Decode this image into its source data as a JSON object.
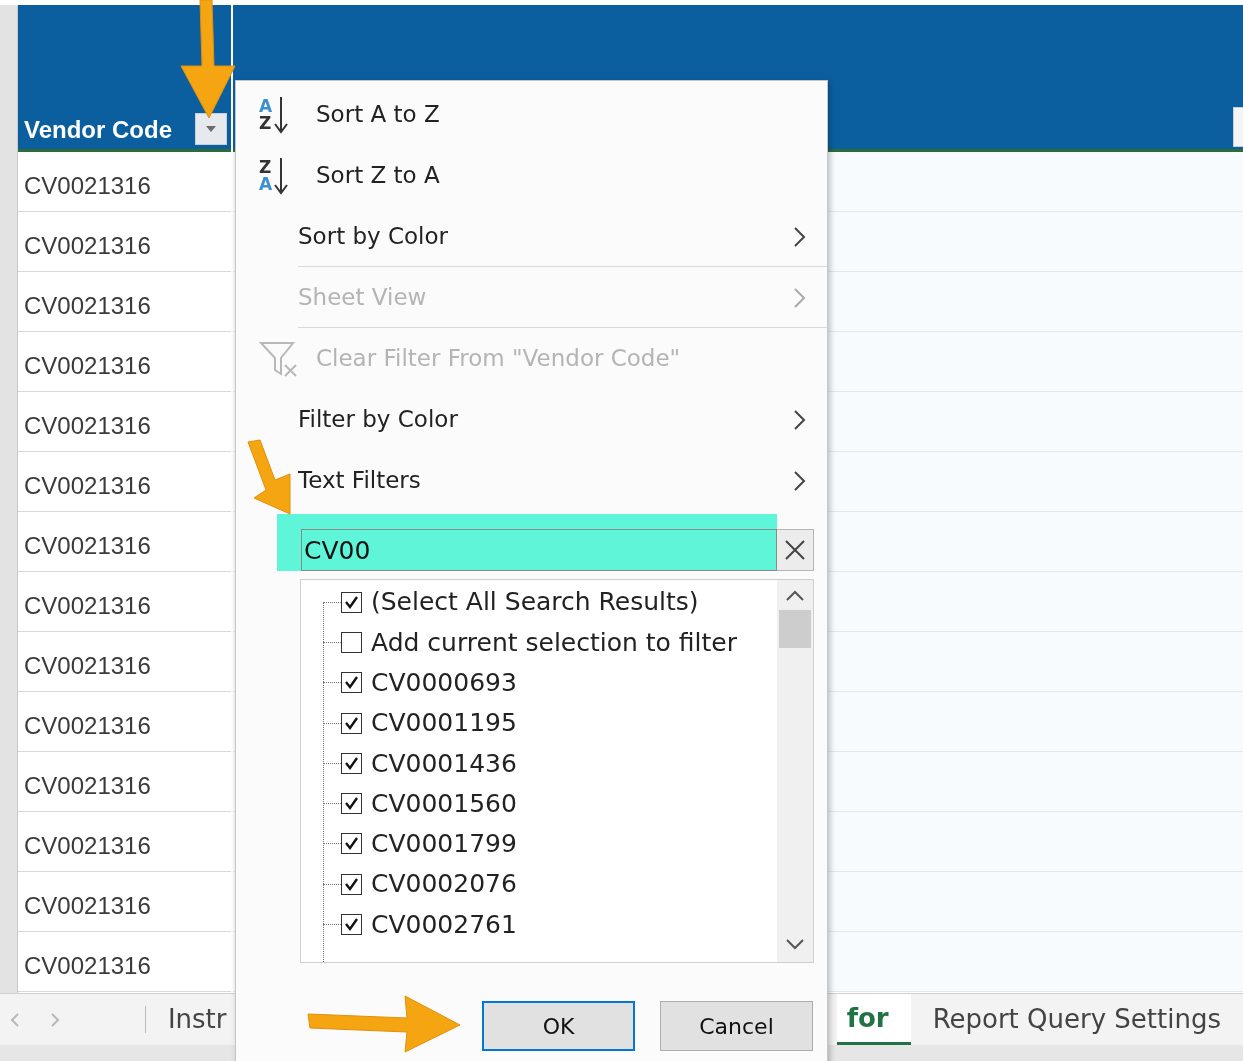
{
  "sheet": {
    "columns": [
      {
        "header": "Vendor Code",
        "filter_button": true
      }
    ],
    "rows": [
      {
        "vendor_code": "CV0021316"
      },
      {
        "vendor_code": "CV0021316"
      },
      {
        "vendor_code": "CV0021316"
      },
      {
        "vendor_code": "CV0021316"
      },
      {
        "vendor_code": "CV0021316"
      },
      {
        "vendor_code": "CV0021316"
      },
      {
        "vendor_code": "CV0021316"
      },
      {
        "vendor_code": "CV0021316"
      },
      {
        "vendor_code": "CV0021316"
      },
      {
        "vendor_code": "CV0021316"
      },
      {
        "vendor_code": "CV0021316"
      },
      {
        "vendor_code": "CV0021316"
      },
      {
        "vendor_code": "CV0021316"
      },
      {
        "vendor_code": "CV0021316"
      }
    ]
  },
  "sheet_tabs": [
    {
      "label": "Instr",
      "selected": false
    },
    {
      "label": "for",
      "selected": true
    },
    {
      "label": "Report Query Settings",
      "selected": false
    }
  ],
  "filter_menu": {
    "items": [
      {
        "kind": "sort",
        "label": "Sort A to Z",
        "disabled": false,
        "divider_after": false,
        "icon_letters": [
          {
            "text": "A",
            "accent": true
          },
          {
            "text": "Z",
            "accent": false
          }
        ]
      },
      {
        "kind": "sort",
        "label": "Sort Z to A",
        "disabled": false,
        "divider_after": false,
        "icon_letters": [
          {
            "text": "Z",
            "accent": false
          },
          {
            "text": "A",
            "accent": true
          }
        ]
      },
      {
        "kind": "submenu",
        "label": "Sort by Color",
        "disabled": false,
        "divider_after": true
      },
      {
        "kind": "submenu",
        "label": "Sheet View",
        "disabled": true,
        "divider_after": true
      },
      {
        "kind": "clear",
        "label": "Clear Filter From \"Vendor Code\"",
        "disabled": true,
        "divider_after": false
      },
      {
        "kind": "submenu",
        "label": "Filter by Color",
        "disabled": false,
        "divider_after": false
      },
      {
        "kind": "submenu",
        "label": "Text Filters",
        "disabled": false,
        "divider_after": false
      }
    ],
    "search": {
      "value": "CV00",
      "highlighted": true
    },
    "list": [
      {
        "label": "(Select All Search Results)",
        "checked": true
      },
      {
        "label": "Add current selection to filter",
        "checked": false
      },
      {
        "label": "CV0000693",
        "checked": true
      },
      {
        "label": "CV0001195",
        "checked": true
      },
      {
        "label": "CV0001436",
        "checked": true
      },
      {
        "label": "CV0001560",
        "checked": true
      },
      {
        "label": "CV0001799",
        "checked": true
      },
      {
        "label": "CV0002076",
        "checked": true
      },
      {
        "label": "CV0002761",
        "checked": true
      }
    ],
    "buttons": [
      {
        "label": "OK",
        "default": true
      },
      {
        "label": "Cancel",
        "default": false
      }
    ]
  }
}
